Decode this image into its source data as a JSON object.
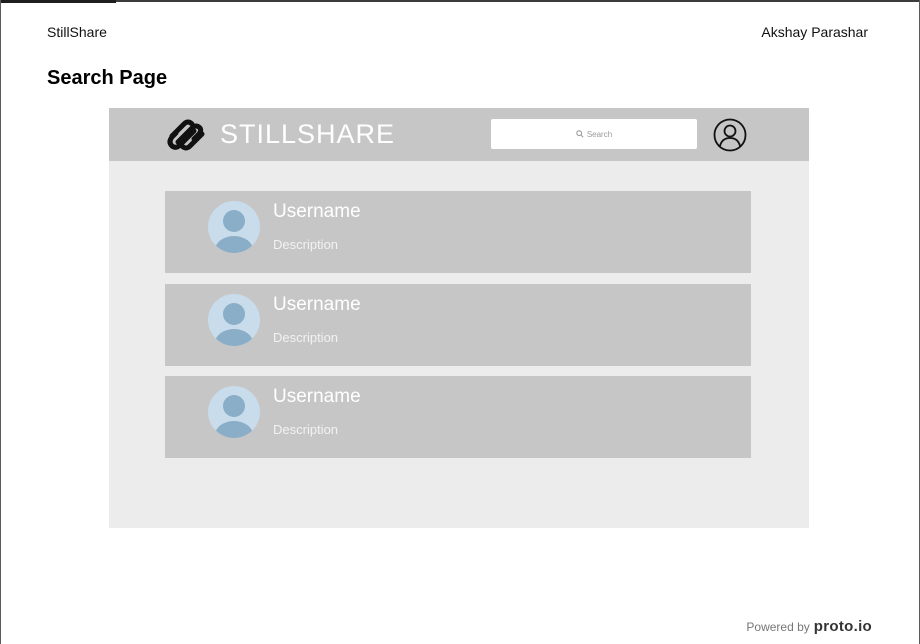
{
  "document": {
    "app_name": "StillShare",
    "author": "Akshay Parashar",
    "page_title": "Search Page"
  },
  "mockup": {
    "brand": "STILLSHARE",
    "logo_icon": "squarespace-style-logo-icon",
    "search": {
      "placeholder": "Search",
      "icon": "search-icon"
    },
    "profile_icon": "user-profile-icon",
    "results": [
      {
        "username": "Username",
        "description": "Description"
      },
      {
        "username": "Username",
        "description": "Description"
      },
      {
        "username": "Username",
        "description": "Description"
      }
    ]
  },
  "footer": {
    "powered_by": "Powered by",
    "brand": "proto.io"
  },
  "colors": {
    "header_bg": "#c6c6c6",
    "canvas_bg": "#ececec",
    "avatar_bg": "#c8dcec",
    "avatar_fg": "#8aaec7"
  }
}
